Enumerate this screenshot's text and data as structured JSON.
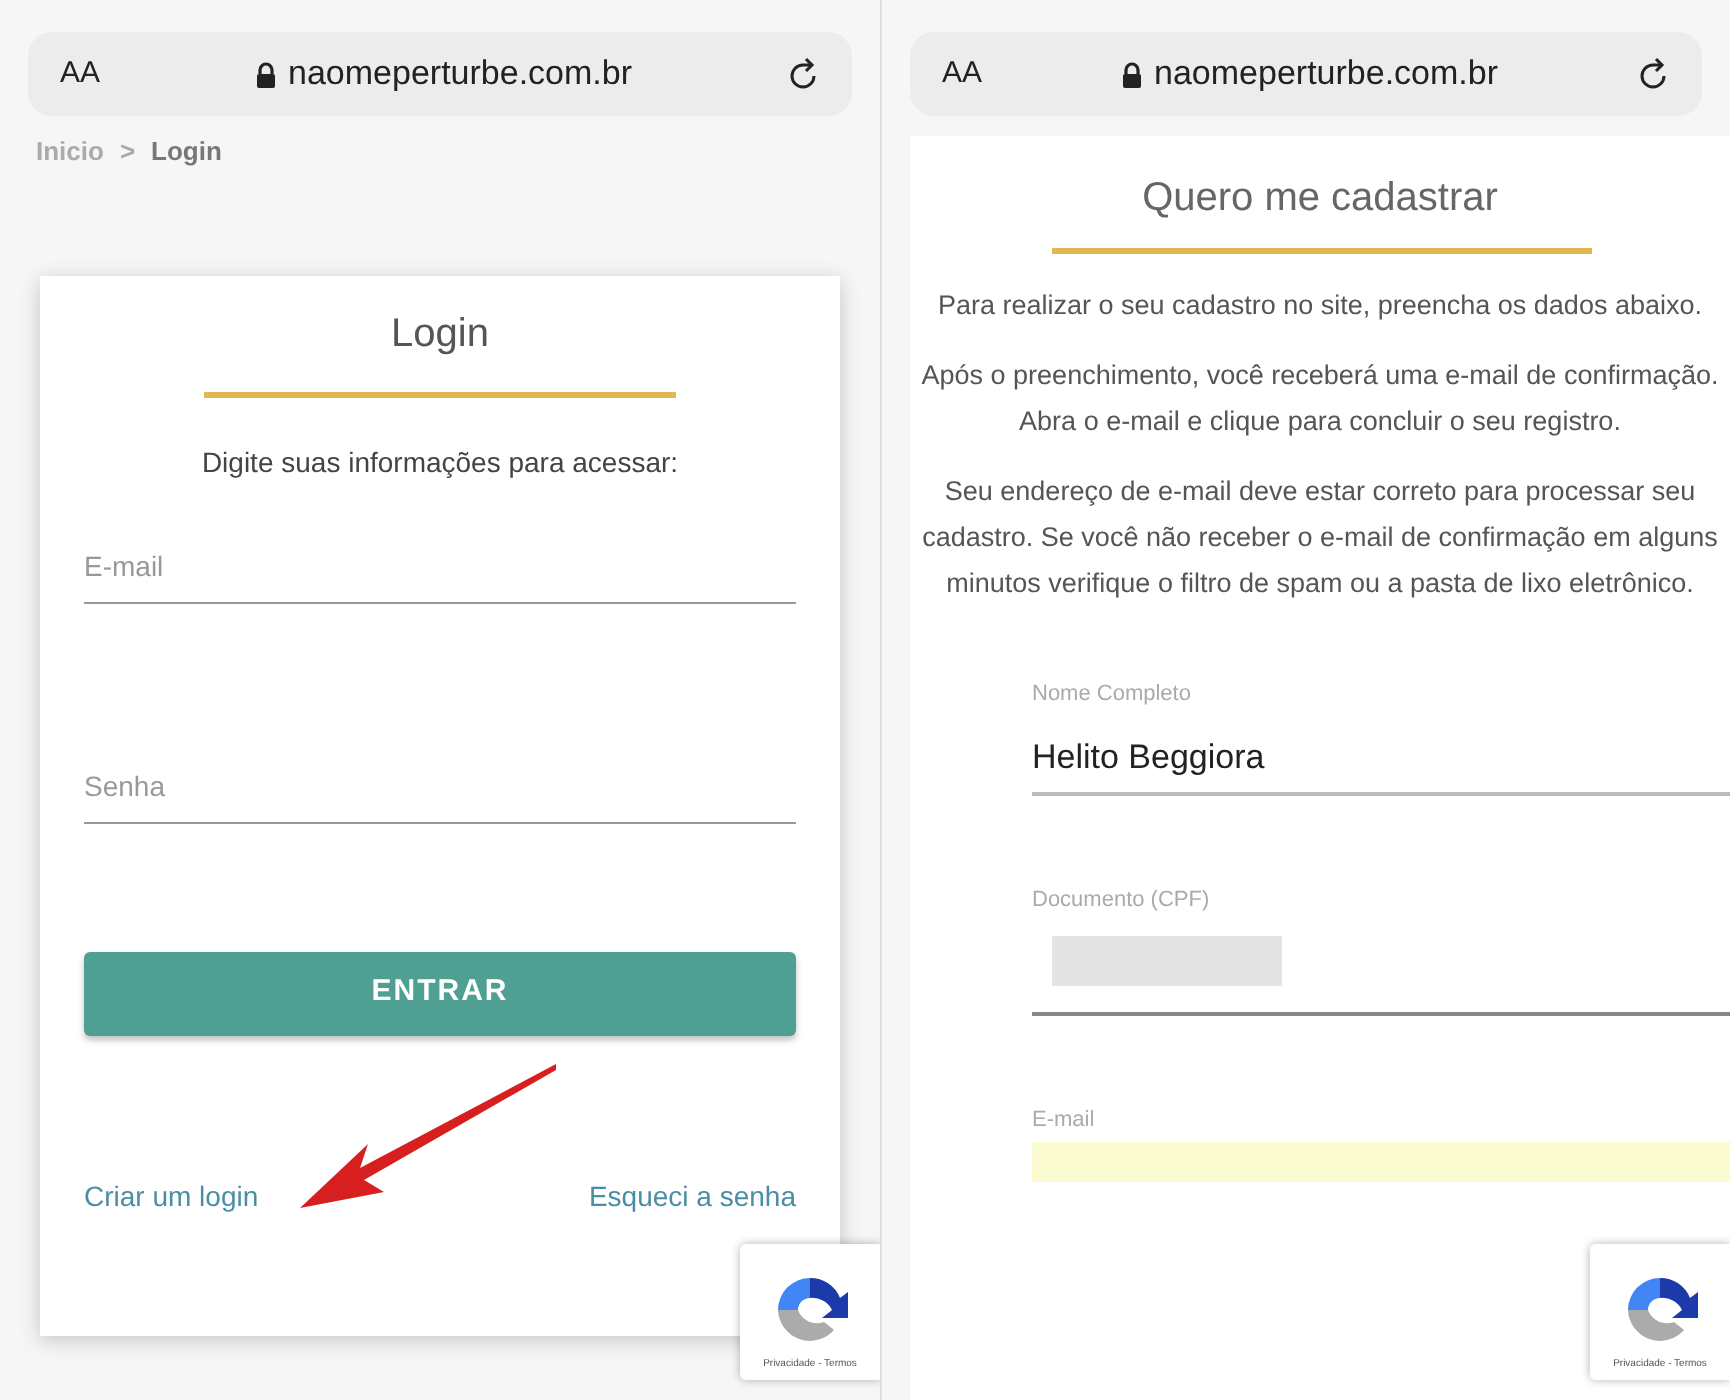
{
  "panes": [
    {
      "address_bar": {
        "text_size": "AA",
        "url": "naomeperturbe.com.br"
      },
      "breadcrumb": [
        {
          "label": "Inicio",
          "selected": false
        },
        {
          "label": ">",
          "selected": false
        },
        {
          "label": "Login",
          "selected": true
        }
      ],
      "title": "Login",
      "intro": "Digite suas informações para acessar:",
      "fields": [
        {
          "placeholder": "E-mail"
        },
        {
          "placeholder": "Senha"
        }
      ],
      "button": "ENTRAR",
      "links": [
        "Criar um login",
        "Esqueci a senha"
      ],
      "recaptcha": "Privacidade - Termos"
    },
    {
      "address_bar": {
        "text_size": "AA",
        "url": "naomeperturbe.com.br"
      },
      "title": "Quero me cadastrar",
      "paragraphs": [
        "Para realizar o seu cadastro no site, preencha os dados abaixo.",
        "Após o preenchimento, você receberá uma e-mail de confirmação. Abra o e-mail e clique para concluir o seu registro.",
        "Seu endereço de e-mail deve estar correto para processar seu cadastro. Se você não receber o e-mail de confirmação em alguns minutos verifique o filtro de spam ou a pasta de lixo eletrônico."
      ],
      "form_fields": [
        {
          "label": "Nome Completo",
          "value": "Helito Beggiora",
          "kind": "filled"
        },
        {
          "label": "Documento (CPF)",
          "kind": "redacted"
        },
        {
          "label": "E-mail",
          "kind": "autofill"
        }
      ],
      "recaptcha": "Privacidade - Termos"
    }
  ]
}
